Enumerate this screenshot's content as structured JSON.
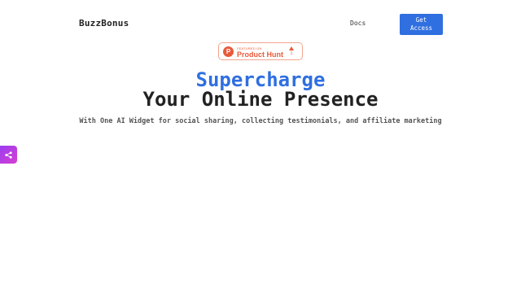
{
  "nav": {
    "logo": "BuzzBonus",
    "docs_label": "Docs",
    "cta_label": "Get Access"
  },
  "badge": {
    "small_text": "FEATURED ON",
    "name": "Product Hunt",
    "icon_letter": "P",
    "upvote_count": "1"
  },
  "hero": {
    "line1": "Supercharge",
    "line2": "Your Online Presence",
    "subtitle": "With One AI Widget for social sharing, collecting testimonials, and affiliate marketing"
  },
  "share_tab": {
    "icon": "share-icon"
  },
  "colors": {
    "accent": "#2f6fe0",
    "product_hunt": "#e95a3a",
    "share_gradient_start": "#9b3df0",
    "share_gradient_end": "#d63fd0"
  }
}
